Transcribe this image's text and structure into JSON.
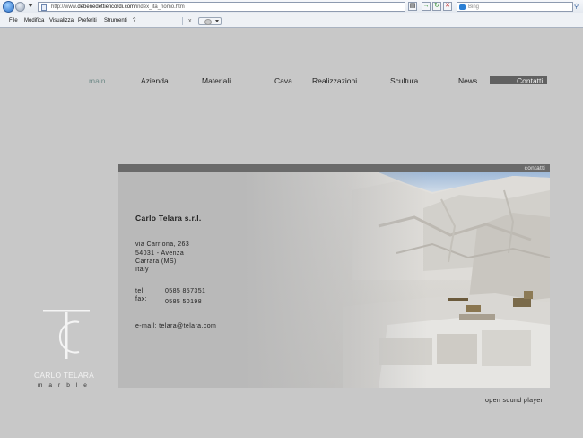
{
  "browser": {
    "url_prefix": "http://www.",
    "url_domain": "debenedettieficordi.com",
    "url_path": "/index_ita_nomo.htm",
    "search_placeholder": "Bing",
    "menu": [
      "File",
      "Modifica",
      "Visualizza",
      "Preferiti",
      "Strumenti",
      "?"
    ]
  },
  "nav": {
    "main": "main",
    "azienda": "Azienda",
    "materiali": "Materiali",
    "cava": "Cava",
    "realizzazioni": "Realizzazioni",
    "scultura": "Scultura",
    "news": "News",
    "contatti": "Contatti"
  },
  "panel": {
    "header": "contatti",
    "company": "Carlo Telara s.r.l.",
    "address": [
      "via Carriona, 263",
      "54031 - Avenza",
      "Carrara (MS)",
      "Italy"
    ],
    "tel_label": "tel:",
    "tel_value": "0585 857351",
    "fax_label": "fax:",
    "fax_value": "0585 50198",
    "email_line": "e-mail: telara@telara.com"
  },
  "logo": {
    "name": "CARLO TELARA",
    "sub": "marble"
  },
  "footer": {
    "sound": "open sound player"
  }
}
